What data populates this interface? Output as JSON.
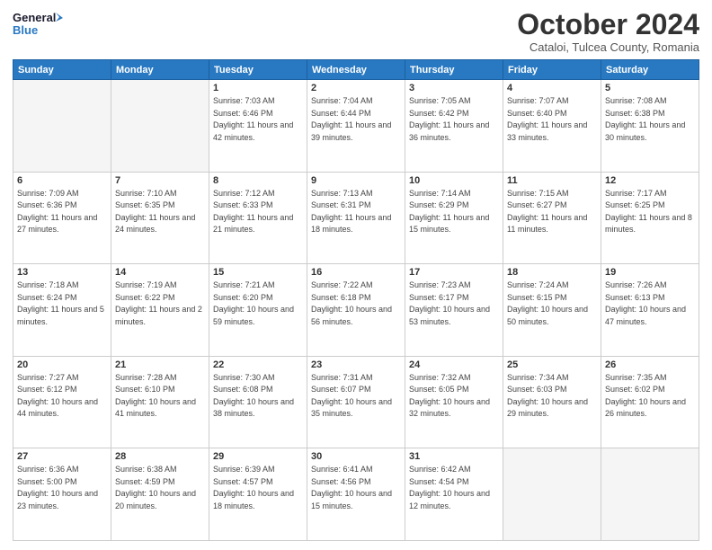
{
  "header": {
    "logo_line1": "General",
    "logo_line2": "Blue",
    "month": "October 2024",
    "location": "Cataloi, Tulcea County, Romania"
  },
  "weekdays": [
    "Sunday",
    "Monday",
    "Tuesday",
    "Wednesday",
    "Thursday",
    "Friday",
    "Saturday"
  ],
  "weeks": [
    [
      {
        "day": "",
        "sunrise": "",
        "sunset": "",
        "daylight": ""
      },
      {
        "day": "",
        "sunrise": "",
        "sunset": "",
        "daylight": ""
      },
      {
        "day": "1",
        "sunrise": "Sunrise: 7:03 AM",
        "sunset": "Sunset: 6:46 PM",
        "daylight": "Daylight: 11 hours and 42 minutes."
      },
      {
        "day": "2",
        "sunrise": "Sunrise: 7:04 AM",
        "sunset": "Sunset: 6:44 PM",
        "daylight": "Daylight: 11 hours and 39 minutes."
      },
      {
        "day": "3",
        "sunrise": "Sunrise: 7:05 AM",
        "sunset": "Sunset: 6:42 PM",
        "daylight": "Daylight: 11 hours and 36 minutes."
      },
      {
        "day": "4",
        "sunrise": "Sunrise: 7:07 AM",
        "sunset": "Sunset: 6:40 PM",
        "daylight": "Daylight: 11 hours and 33 minutes."
      },
      {
        "day": "5",
        "sunrise": "Sunrise: 7:08 AM",
        "sunset": "Sunset: 6:38 PM",
        "daylight": "Daylight: 11 hours and 30 minutes."
      }
    ],
    [
      {
        "day": "6",
        "sunrise": "Sunrise: 7:09 AM",
        "sunset": "Sunset: 6:36 PM",
        "daylight": "Daylight: 11 hours and 27 minutes."
      },
      {
        "day": "7",
        "sunrise": "Sunrise: 7:10 AM",
        "sunset": "Sunset: 6:35 PM",
        "daylight": "Daylight: 11 hours and 24 minutes."
      },
      {
        "day": "8",
        "sunrise": "Sunrise: 7:12 AM",
        "sunset": "Sunset: 6:33 PM",
        "daylight": "Daylight: 11 hours and 21 minutes."
      },
      {
        "day": "9",
        "sunrise": "Sunrise: 7:13 AM",
        "sunset": "Sunset: 6:31 PM",
        "daylight": "Daylight: 11 hours and 18 minutes."
      },
      {
        "day": "10",
        "sunrise": "Sunrise: 7:14 AM",
        "sunset": "Sunset: 6:29 PM",
        "daylight": "Daylight: 11 hours and 15 minutes."
      },
      {
        "day": "11",
        "sunrise": "Sunrise: 7:15 AM",
        "sunset": "Sunset: 6:27 PM",
        "daylight": "Daylight: 11 hours and 11 minutes."
      },
      {
        "day": "12",
        "sunrise": "Sunrise: 7:17 AM",
        "sunset": "Sunset: 6:25 PM",
        "daylight": "Daylight: 11 hours and 8 minutes."
      }
    ],
    [
      {
        "day": "13",
        "sunrise": "Sunrise: 7:18 AM",
        "sunset": "Sunset: 6:24 PM",
        "daylight": "Daylight: 11 hours and 5 minutes."
      },
      {
        "day": "14",
        "sunrise": "Sunrise: 7:19 AM",
        "sunset": "Sunset: 6:22 PM",
        "daylight": "Daylight: 11 hours and 2 minutes."
      },
      {
        "day": "15",
        "sunrise": "Sunrise: 7:21 AM",
        "sunset": "Sunset: 6:20 PM",
        "daylight": "Daylight: 10 hours and 59 minutes."
      },
      {
        "day": "16",
        "sunrise": "Sunrise: 7:22 AM",
        "sunset": "Sunset: 6:18 PM",
        "daylight": "Daylight: 10 hours and 56 minutes."
      },
      {
        "day": "17",
        "sunrise": "Sunrise: 7:23 AM",
        "sunset": "Sunset: 6:17 PM",
        "daylight": "Daylight: 10 hours and 53 minutes."
      },
      {
        "day": "18",
        "sunrise": "Sunrise: 7:24 AM",
        "sunset": "Sunset: 6:15 PM",
        "daylight": "Daylight: 10 hours and 50 minutes."
      },
      {
        "day": "19",
        "sunrise": "Sunrise: 7:26 AM",
        "sunset": "Sunset: 6:13 PM",
        "daylight": "Daylight: 10 hours and 47 minutes."
      }
    ],
    [
      {
        "day": "20",
        "sunrise": "Sunrise: 7:27 AM",
        "sunset": "Sunset: 6:12 PM",
        "daylight": "Daylight: 10 hours and 44 minutes."
      },
      {
        "day": "21",
        "sunrise": "Sunrise: 7:28 AM",
        "sunset": "Sunset: 6:10 PM",
        "daylight": "Daylight: 10 hours and 41 minutes."
      },
      {
        "day": "22",
        "sunrise": "Sunrise: 7:30 AM",
        "sunset": "Sunset: 6:08 PM",
        "daylight": "Daylight: 10 hours and 38 minutes."
      },
      {
        "day": "23",
        "sunrise": "Sunrise: 7:31 AM",
        "sunset": "Sunset: 6:07 PM",
        "daylight": "Daylight: 10 hours and 35 minutes."
      },
      {
        "day": "24",
        "sunrise": "Sunrise: 7:32 AM",
        "sunset": "Sunset: 6:05 PM",
        "daylight": "Daylight: 10 hours and 32 minutes."
      },
      {
        "day": "25",
        "sunrise": "Sunrise: 7:34 AM",
        "sunset": "Sunset: 6:03 PM",
        "daylight": "Daylight: 10 hours and 29 minutes."
      },
      {
        "day": "26",
        "sunrise": "Sunrise: 7:35 AM",
        "sunset": "Sunset: 6:02 PM",
        "daylight": "Daylight: 10 hours and 26 minutes."
      }
    ],
    [
      {
        "day": "27",
        "sunrise": "Sunrise: 6:36 AM",
        "sunset": "Sunset: 5:00 PM",
        "daylight": "Daylight: 10 hours and 23 minutes."
      },
      {
        "day": "28",
        "sunrise": "Sunrise: 6:38 AM",
        "sunset": "Sunset: 4:59 PM",
        "daylight": "Daylight: 10 hours and 20 minutes."
      },
      {
        "day": "29",
        "sunrise": "Sunrise: 6:39 AM",
        "sunset": "Sunset: 4:57 PM",
        "daylight": "Daylight: 10 hours and 18 minutes."
      },
      {
        "day": "30",
        "sunrise": "Sunrise: 6:41 AM",
        "sunset": "Sunset: 4:56 PM",
        "daylight": "Daylight: 10 hours and 15 minutes."
      },
      {
        "day": "31",
        "sunrise": "Sunrise: 6:42 AM",
        "sunset": "Sunset: 4:54 PM",
        "daylight": "Daylight: 10 hours and 12 minutes."
      },
      {
        "day": "",
        "sunrise": "",
        "sunset": "",
        "daylight": ""
      },
      {
        "day": "",
        "sunrise": "",
        "sunset": "",
        "daylight": ""
      }
    ]
  ]
}
